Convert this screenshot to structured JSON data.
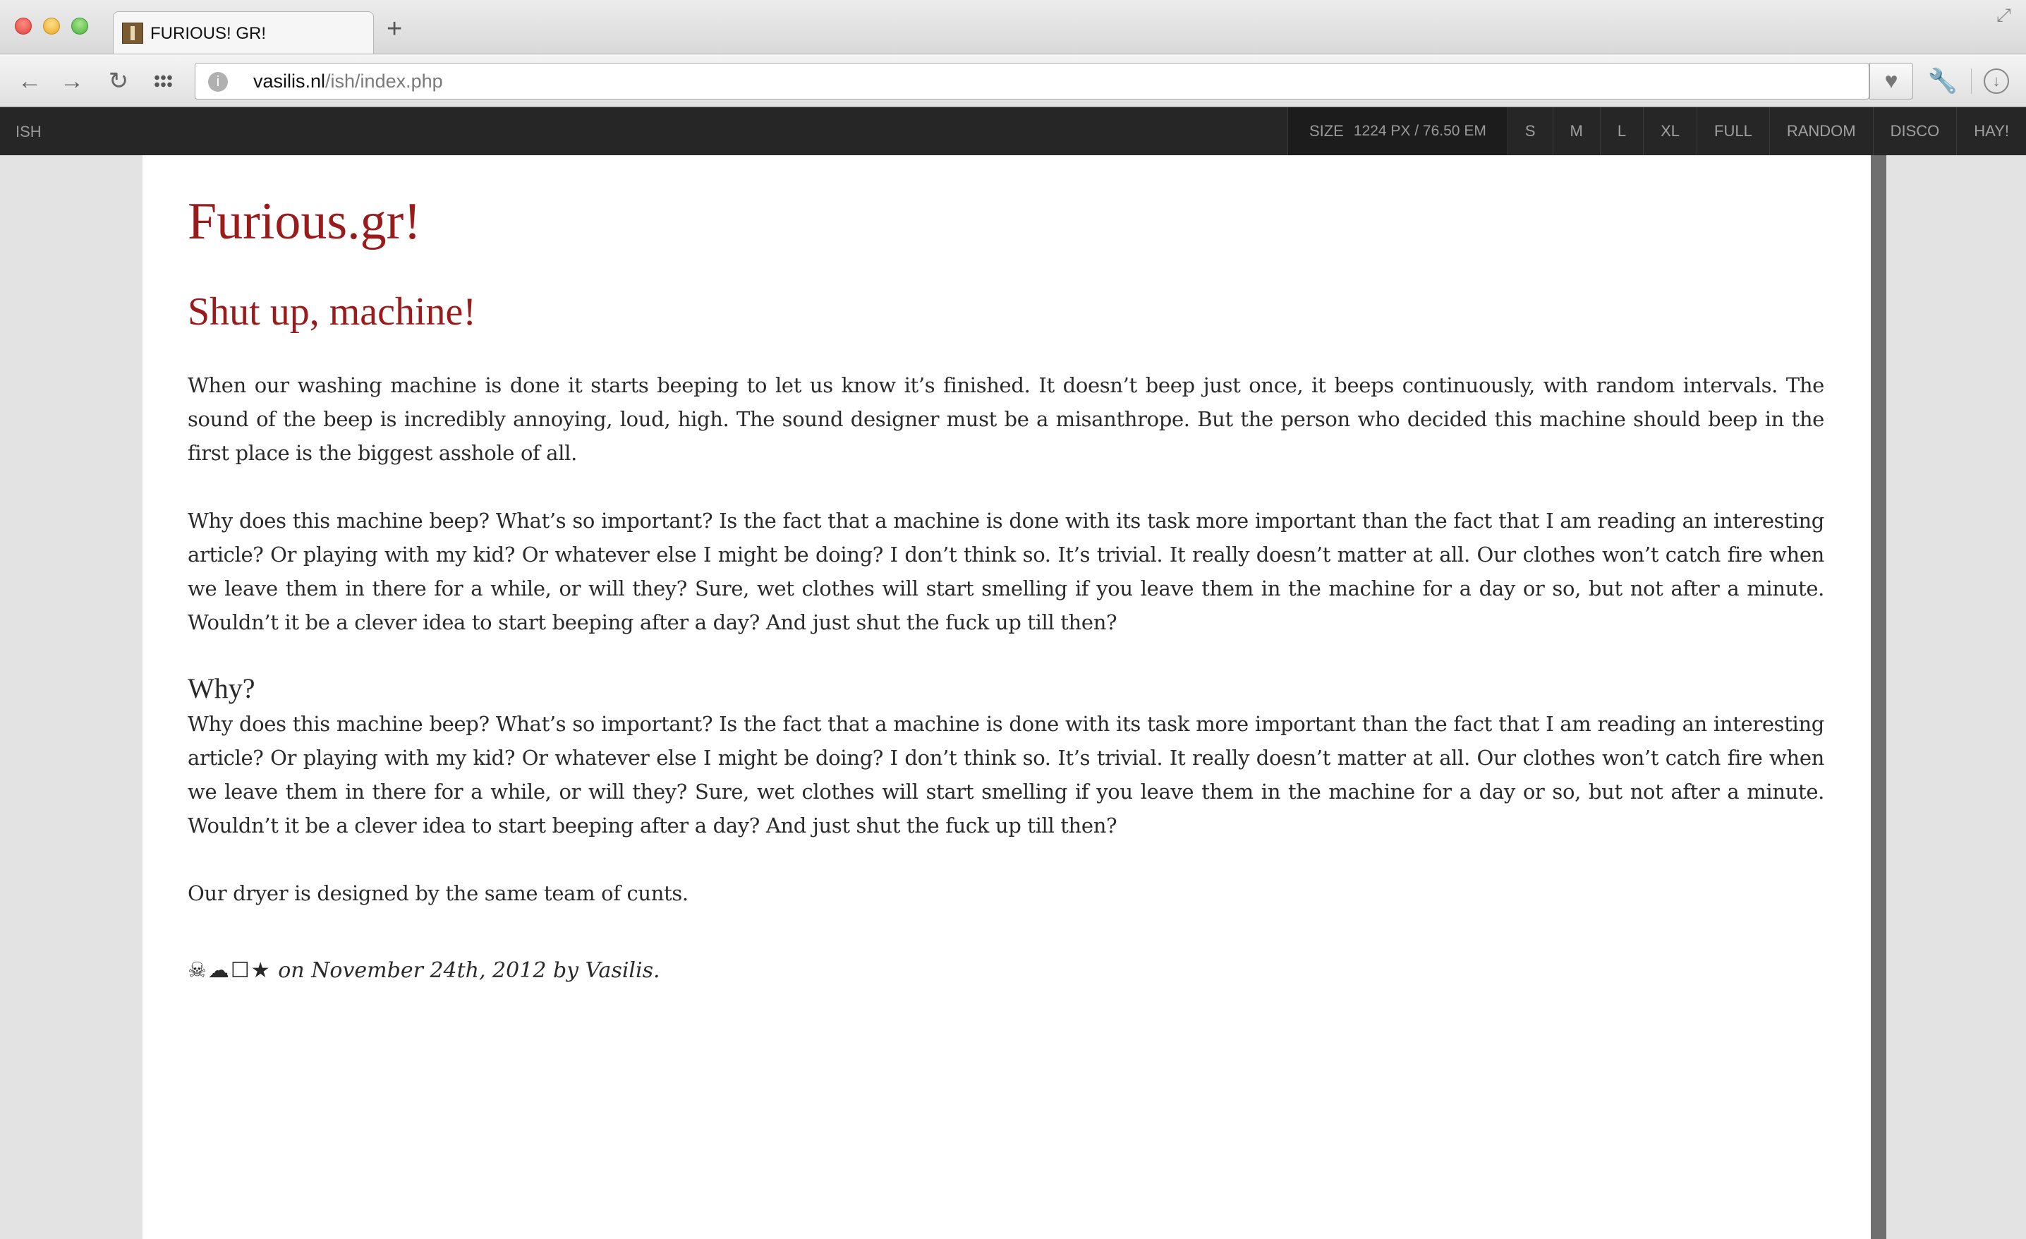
{
  "browser": {
    "tab_title": "FURIOUS! GR!",
    "new_tab_symbol": "+",
    "url_host": "vasilis.nl",
    "url_path": "/ish/index.php",
    "icons": [
      "back-arrow-icon",
      "forward-arrow-icon",
      "reload-icon",
      "apps-grid-icon",
      "site-info-icon",
      "heart-icon",
      "wrench-icon",
      "download-icon",
      "fullscreen-icon"
    ]
  },
  "ish": {
    "logo": "ISH",
    "size_label": "SIZE",
    "size_value": "1224 PX / 76.50 EM",
    "buttons": [
      "S",
      "M",
      "L",
      "XL",
      "FULL",
      "RANDOM",
      "DISCO",
      "HAY!"
    ]
  },
  "page": {
    "site_title": "Furious.gr!",
    "post_title": "Shut up, machine!",
    "paragraph_1": "When our washing machine is done it starts beeping to let us know it’s finished. It doesn’t beep just once, it beeps continuously, with random intervals. The sound of the beep is incredibly annoying, loud, high. The sound designer must be a misanthrope. But the person who decided this machine should beep in the first place is the biggest asshole of all.",
    "paragraph_2": "Why does this machine beep? What’s so important? Is the fact that a machine is done with its task more important than the fact that I am reading an interesting article? Or playing with my kid? Or whatever else I might be doing? I don’t think so. It’s trivial. It really doesn’t matter at all. Our clothes won’t catch fire when we leave them in there for a while, or will they? Sure, wet clothes will start smelling if you leave them in the machine for a day or so, but not after a minute. Wouldn’t it be a clever idea to start beeping after a day? And just shut the fuck up till then?",
    "subheading": "Why?",
    "paragraph_3": "Why does this machine beep? What’s so important? Is the fact that a machine is done with its task more important than the fact that I am reading an interesting article? Or playing with my kid? Or whatever else I might be doing? I don’t think so. It’s trivial. It really doesn’t matter at all. Our clothes won’t catch fire when we leave them in there for a while, or will they? Sure, wet clothes will start smelling if you leave them in the machine for a day or so, but not after a minute. Wouldn’t it be a clever idea to start beeping after a day? And just shut the fuck up till then?",
    "paragraph_4": "Our dryer is designed by the same team of cunts.",
    "meta_icons": "☠☁☐★",
    "meta_text": "on November 24th, 2012 by Vasilis."
  },
  "colors": {
    "accent": "#9a1b1b",
    "ish_bar": "#262626",
    "page_bg": "#ffffff",
    "surround_bg": "#e3e3e3"
  }
}
